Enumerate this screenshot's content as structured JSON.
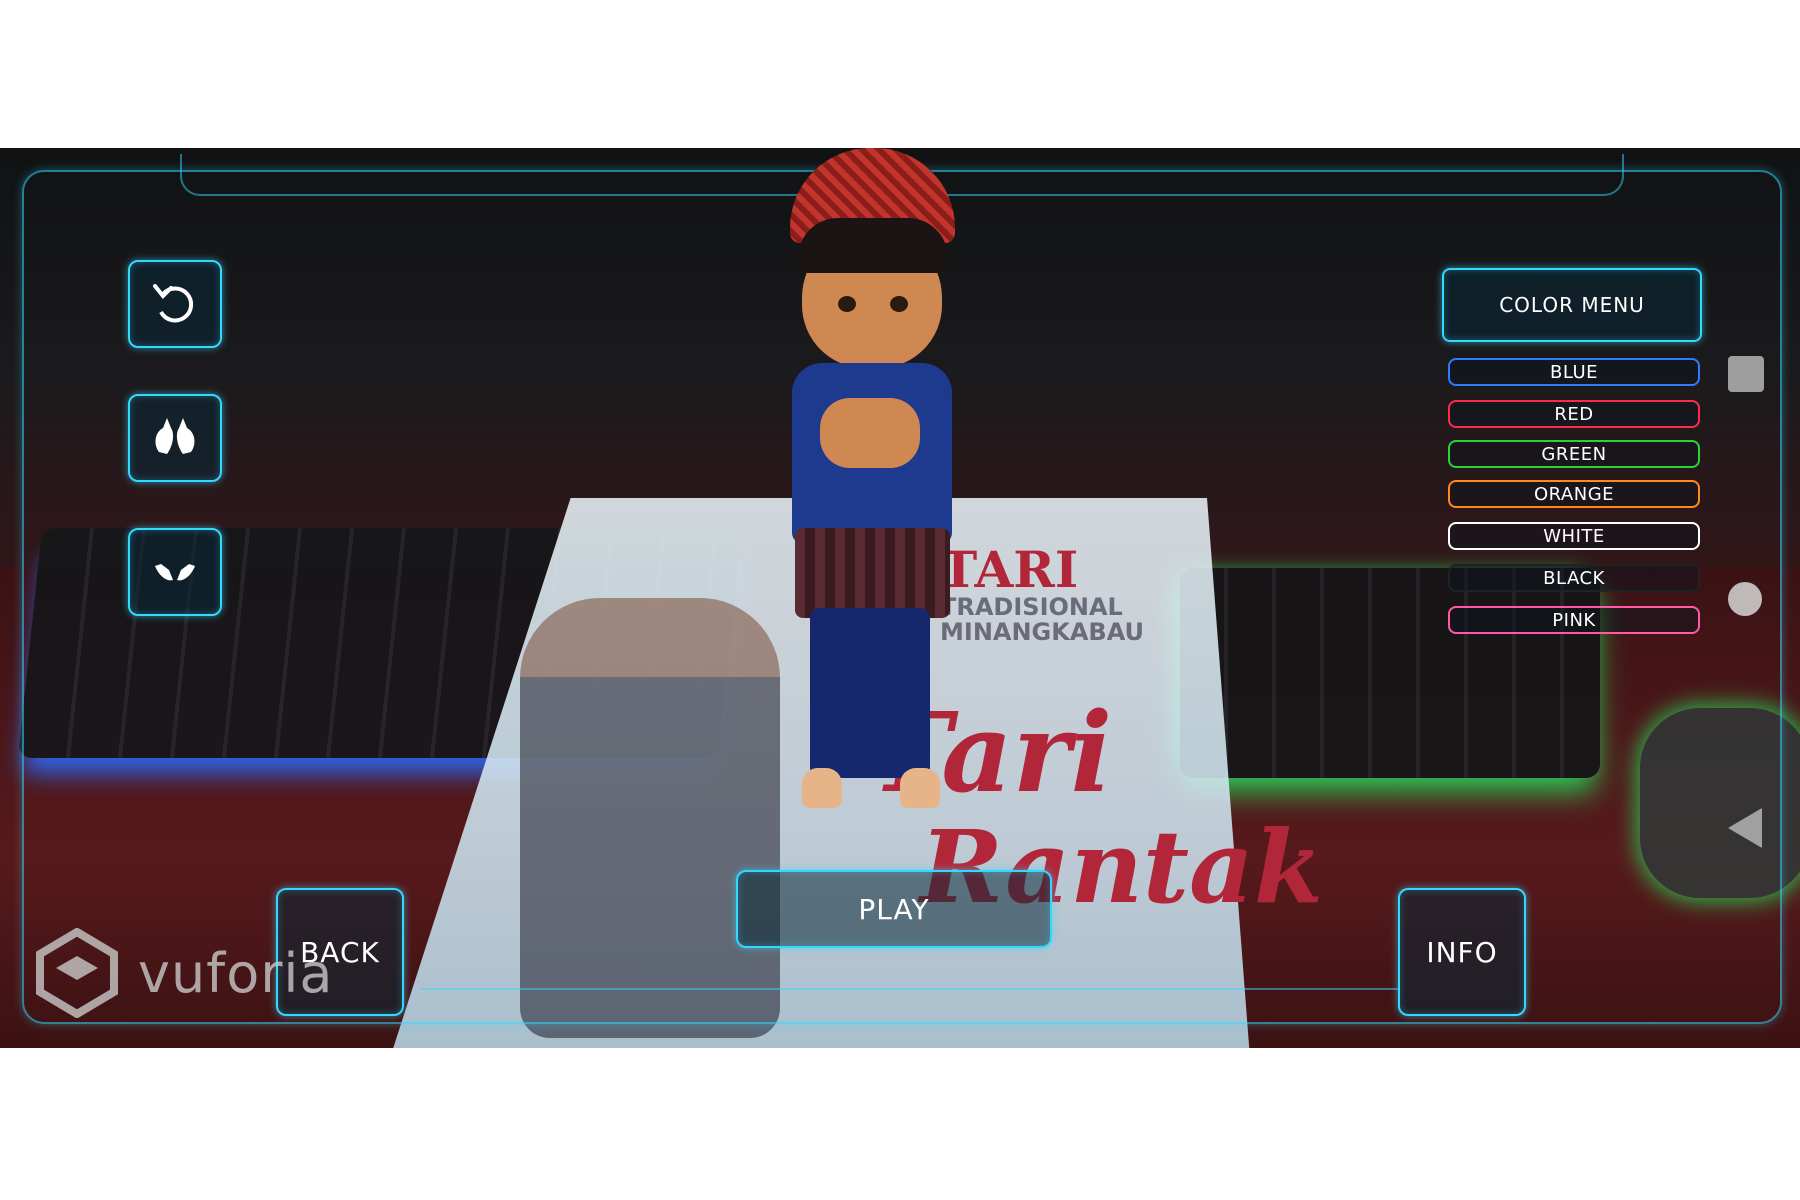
{
  "hud": {
    "rotate_button_icon": "rotate-icon",
    "gesture_up_icon": "hands-up-icon",
    "gesture_down_icon": "hands-down-icon",
    "color_menu_label": "COLOR MENU",
    "colors": [
      {
        "label": "BLUE",
        "color": "#2f7bff"
      },
      {
        "label": "RED",
        "color": "#ff2a4a"
      },
      {
        "label": "GREEN",
        "color": "#28d43a"
      },
      {
        "label": "ORANGE",
        "color": "#ff8a1a"
      },
      {
        "label": "WHITE",
        "color": "#ffffff"
      },
      {
        "label": "BLACK",
        "color": "#222222"
      },
      {
        "label": "PINK",
        "color": "#ff5aa8"
      }
    ],
    "back_label": "BACK",
    "play_label": "PLAY",
    "info_label": "INFO",
    "accent_color": "#33d8ff"
  },
  "scene": {
    "poster_title": "TARI",
    "poster_subtitle_1": "TRADISIONAL",
    "poster_subtitle_2": "MINANGKABAU",
    "poster_script_1": "Tari",
    "poster_script_2": "Rantak"
  },
  "watermark": {
    "brand": "vuforia"
  },
  "system_nav": {
    "recent_icon": "square-icon",
    "home_icon": "circle-icon",
    "back_icon": "triangle-back-icon"
  }
}
